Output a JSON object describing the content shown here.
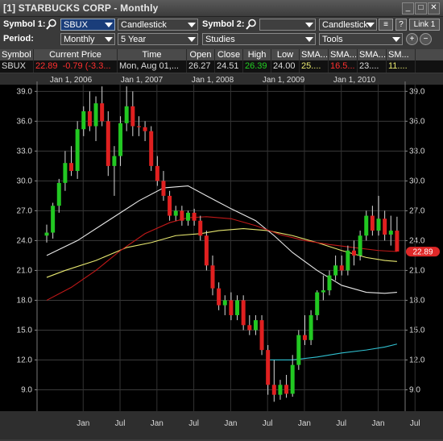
{
  "window": {
    "title": "[1] STARBUCKS CORP - Monthly"
  },
  "toolbar": {
    "symbol1_label": "Symbol 1:",
    "symbol1_value": "SBUX",
    "chart_type1": "Candlestick",
    "symbol2_label": "Symbol 2:",
    "symbol2_value": "",
    "chart_type2": "Candlestick",
    "help": "?",
    "link": "Link 1",
    "period_label": "Period:",
    "period_value": "Monthly",
    "range_value": "5 Year",
    "studies_value": "Studies",
    "tools_value": "Tools"
  },
  "quote": {
    "headers": [
      "Symbol",
      "Current Price",
      "Time",
      "Open",
      "Close",
      "High",
      "Low",
      "SMA...",
      "SMA...",
      "SMA...",
      "SM..."
    ],
    "symbol": "SBUX",
    "current_price": "22.89",
    "change": "-0.79 (-3.3...",
    "time": "Mon, Aug 01,...",
    "open": "26.27",
    "close": "24.51",
    "high": "26.39",
    "low": "24.00",
    "sma1": "25....",
    "sma2": "16.5...",
    "sma3": "23....",
    "sma4": "11...."
  },
  "colors": {
    "up": "#22c822",
    "down": "#e02020",
    "sma_yellow": "#e8e870",
    "sma_red": "#c01818",
    "sma_white": "#e6e6e6",
    "sma_cyan": "#30c0d0",
    "price_badge": "#e02828"
  },
  "chart_data": {
    "type": "candlestick",
    "title": "",
    "yticks": [
      9.0,
      12.0,
      15.0,
      18.0,
      21.0,
      24.0,
      27.0,
      30.0,
      33.0,
      36.0,
      39.0
    ],
    "ylim": [
      7.5,
      40.0
    ],
    "year_labels": [
      "Jan 1, 2006",
      "Jan 1, 2007",
      "Jan 1, 2008",
      "Jan 1, 2009",
      "Jan 1, 2010"
    ],
    "month_labels": [
      "Jan",
      "Jul",
      "Jan",
      "Jul",
      "Jan",
      "Jul",
      "Jan",
      "Jul",
      "Jan",
      "Jul",
      "Jan",
      "Jul"
    ],
    "last_price_label": "22.89",
    "candles": [
      {
        "o": 24.5,
        "h": 25.6,
        "l": 23.8,
        "c": 24.8
      },
      {
        "o": 24.8,
        "h": 27.8,
        "l": 24.2,
        "c": 27.5
      },
      {
        "o": 27.5,
        "h": 30.2,
        "l": 26.8,
        "c": 29.8
      },
      {
        "o": 29.8,
        "h": 33.0,
        "l": 29.0,
        "c": 31.8
      },
      {
        "o": 31.8,
        "h": 33.5,
        "l": 30.5,
        "c": 31.0
      },
      {
        "o": 31.0,
        "h": 36.0,
        "l": 30.2,
        "c": 35.2
      },
      {
        "o": 35.2,
        "h": 37.5,
        "l": 34.5,
        "c": 37.0
      },
      {
        "o": 37.0,
        "h": 39.0,
        "l": 35.0,
        "c": 35.5
      },
      {
        "o": 35.5,
        "h": 38.5,
        "l": 34.0,
        "c": 37.8
      },
      {
        "o": 37.8,
        "h": 39.5,
        "l": 35.5,
        "c": 36.0
      },
      {
        "o": 36.0,
        "h": 37.0,
        "l": 30.5,
        "c": 31.5
      },
      {
        "o": 31.5,
        "h": 33.5,
        "l": 28.5,
        "c": 32.5
      },
      {
        "o": 32.5,
        "h": 36.5,
        "l": 31.5,
        "c": 35.8
      },
      {
        "o": 35.8,
        "h": 39.5,
        "l": 35.0,
        "c": 37.5
      },
      {
        "o": 37.5,
        "h": 39.0,
        "l": 34.5,
        "c": 35.5
      },
      {
        "o": 35.5,
        "h": 36.5,
        "l": 34.5,
        "c": 35.4
      },
      {
        "o": 35.4,
        "h": 36.0,
        "l": 34.0,
        "c": 35.0
      },
      {
        "o": 35.0,
        "h": 35.5,
        "l": 31.0,
        "c": 31.5
      },
      {
        "o": 31.5,
        "h": 32.5,
        "l": 29.5,
        "c": 30.0
      },
      {
        "o": 30.0,
        "h": 31.0,
        "l": 28.0,
        "c": 28.5
      },
      {
        "o": 28.5,
        "h": 29.0,
        "l": 26.0,
        "c": 26.5
      },
      {
        "o": 26.5,
        "h": 27.5,
        "l": 26.0,
        "c": 27.0
      },
      {
        "o": 27.0,
        "h": 27.5,
        "l": 25.5,
        "c": 26.0
      },
      {
        "o": 26.0,
        "h": 27.0,
        "l": 25.5,
        "c": 26.8
      },
      {
        "o": 26.8,
        "h": 27.2,
        "l": 25.5,
        "c": 26.0
      },
      {
        "o": 26.0,
        "h": 26.5,
        "l": 24.0,
        "c": 24.5
      },
      {
        "o": 24.5,
        "h": 25.0,
        "l": 21.0,
        "c": 21.5
      },
      {
        "o": 21.5,
        "h": 22.5,
        "l": 18.5,
        "c": 19.2
      },
      {
        "o": 19.2,
        "h": 19.8,
        "l": 17.0,
        "c": 17.5
      },
      {
        "o": 17.5,
        "h": 18.5,
        "l": 16.5,
        "c": 18.0
      },
      {
        "o": 18.0,
        "h": 18.8,
        "l": 16.0,
        "c": 16.5
      },
      {
        "o": 16.5,
        "h": 18.5,
        "l": 16.0,
        "c": 18.0
      },
      {
        "o": 18.0,
        "h": 18.5,
        "l": 15.0,
        "c": 15.5
      },
      {
        "o": 15.5,
        "h": 16.5,
        "l": 14.5,
        "c": 15.0
      },
      {
        "o": 15.0,
        "h": 16.5,
        "l": 14.5,
        "c": 16.0
      },
      {
        "o": 16.0,
        "h": 16.5,
        "l": 12.5,
        "c": 13.0
      },
      {
        "o": 13.0,
        "h": 13.5,
        "l": 8.5,
        "c": 9.5
      },
      {
        "o": 9.5,
        "h": 12.0,
        "l": 7.8,
        "c": 8.5
      },
      {
        "o": 8.5,
        "h": 10.0,
        "l": 8.0,
        "c": 9.5
      },
      {
        "o": 9.5,
        "h": 10.5,
        "l": 8.2,
        "c": 8.6
      },
      {
        "o": 8.6,
        "h": 12.5,
        "l": 8.3,
        "c": 11.5
      },
      {
        "o": 11.5,
        "h": 15.0,
        "l": 11.0,
        "c": 14.5
      },
      {
        "o": 14.5,
        "h": 16.5,
        "l": 13.5,
        "c": 14.0
      },
      {
        "o": 14.0,
        "h": 17.0,
        "l": 13.5,
        "c": 16.5
      },
      {
        "o": 16.5,
        "h": 19.0,
        "l": 16.0,
        "c": 18.8
      },
      {
        "o": 18.8,
        "h": 20.5,
        "l": 18.0,
        "c": 19.0
      },
      {
        "o": 19.0,
        "h": 21.0,
        "l": 18.5,
        "c": 20.5
      },
      {
        "o": 20.5,
        "h": 22.5,
        "l": 20.0,
        "c": 21.5
      },
      {
        "o": 21.5,
        "h": 22.5,
        "l": 20.5,
        "c": 21.0
      },
      {
        "o": 21.0,
        "h": 23.5,
        "l": 20.5,
        "c": 23.0
      },
      {
        "o": 23.0,
        "h": 24.0,
        "l": 21.5,
        "c": 22.5
      },
      {
        "o": 22.5,
        "h": 25.0,
        "l": 22.0,
        "c": 24.5
      },
      {
        "o": 24.5,
        "h": 27.0,
        "l": 24.0,
        "c": 26.5
      },
      {
        "o": 26.5,
        "h": 27.5,
        "l": 24.5,
        "c": 25.0
      },
      {
        "o": 25.0,
        "h": 28.5,
        "l": 24.5,
        "c": 26.2
      },
      {
        "o": 26.2,
        "h": 27.0,
        "l": 24.0,
        "c": 24.6
      },
      {
        "o": 24.6,
        "h": 26.5,
        "l": 23.5,
        "c": 25.0
      },
      {
        "o": 25.0,
        "h": 26.4,
        "l": 24.0,
        "c": 22.9
      }
    ],
    "sma_series": [
      {
        "color": "#e8e870",
        "values": [
          [
            0,
            20.3
          ],
          [
            3,
            21.0
          ],
          [
            8,
            22.0
          ],
          [
            13,
            23.3
          ],
          [
            17,
            23.8
          ],
          [
            21,
            24.5
          ],
          [
            25,
            24.7
          ],
          [
            28,
            25.0
          ],
          [
            32,
            25.2
          ],
          [
            36,
            25.0
          ],
          [
            40,
            24.5
          ],
          [
            44,
            23.8
          ],
          [
            48,
            23.0
          ],
          [
            52,
            22.3
          ],
          [
            55,
            22.0
          ],
          [
            57,
            21.9
          ]
        ]
      },
      {
        "color": "#e8e8e8",
        "values": [
          [
            0,
            22.5
          ],
          [
            5,
            24.0
          ],
          [
            10,
            26.0
          ],
          [
            15,
            28.0
          ],
          [
            19,
            29.3
          ],
          [
            23,
            29.5
          ],
          [
            26,
            28.5
          ],
          [
            30,
            27.2
          ],
          [
            34,
            26.0
          ],
          [
            37,
            24.5
          ],
          [
            40,
            22.8
          ],
          [
            44,
            21.0
          ],
          [
            48,
            19.5
          ],
          [
            52,
            18.8
          ],
          [
            55,
            18.7
          ],
          [
            57,
            18.8
          ]
        ]
      },
      {
        "color": "#c01818",
        "values": [
          [
            0,
            18.0
          ],
          [
            4,
            19.3
          ],
          [
            8,
            21.0
          ],
          [
            12,
            23.0
          ],
          [
            16,
            24.7
          ],
          [
            20,
            25.8
          ],
          [
            23,
            26.3
          ],
          [
            26,
            26.4
          ],
          [
            30,
            26.2
          ],
          [
            34,
            25.5
          ],
          [
            38,
            24.6
          ],
          [
            42,
            24.0
          ],
          [
            46,
            23.6
          ],
          [
            50,
            23.3
          ],
          [
            54,
            23.0
          ],
          [
            57,
            22.9
          ]
        ]
      },
      {
        "color": "#30c0d0",
        "values": [
          [
            36,
            12.0
          ],
          [
            40,
            12.0
          ],
          [
            44,
            12.3
          ],
          [
            48,
            12.7
          ],
          [
            52,
            13.0
          ],
          [
            55,
            13.3
          ],
          [
            57,
            13.6
          ]
        ]
      }
    ]
  }
}
